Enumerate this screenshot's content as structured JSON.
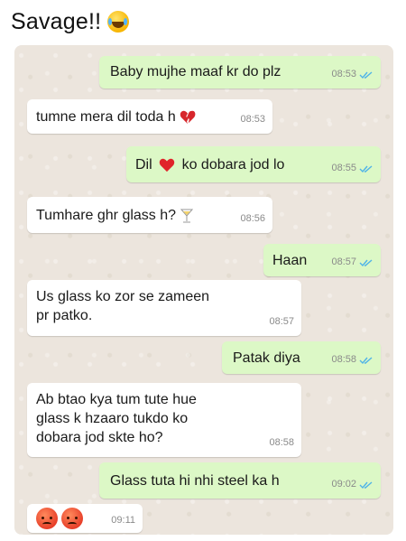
{
  "caption": {
    "text": "Savage!!",
    "emoji": "tears-of-joy-emoji"
  },
  "colors": {
    "chat_background": "#ece5dd",
    "outgoing_bubble": "#dcf8c6",
    "incoming_bubble": "#ffffff",
    "read_ticks": "#4fb3e8"
  },
  "messages": [
    {
      "direction": "out",
      "text": "Baby mujhe maaf kr do plz",
      "time": "08:53",
      "status": "read"
    },
    {
      "direction": "in",
      "text": "tumne mera dil toda h",
      "emoji": "broken-heart-emoji",
      "time": "08:53"
    },
    {
      "direction": "out",
      "text_before": "Dil",
      "emoji": "red-heart-emoji",
      "text_after": "ko dobara jod lo",
      "time": "08:55",
      "status": "read"
    },
    {
      "direction": "in",
      "text": "Tumhare ghr glass h?",
      "emoji": "cocktail-glass-emoji",
      "time": "08:56"
    },
    {
      "direction": "out",
      "text": "Haan",
      "time": "08:57",
      "status": "read"
    },
    {
      "direction": "in",
      "text_line1": "Us glass ko zor se zameen",
      "text_line2": "pr patko.",
      "time": "08:57"
    },
    {
      "direction": "out",
      "text": "Patak diya",
      "time": "08:58",
      "status": "read"
    },
    {
      "direction": "in",
      "text_line1": "Ab btao kya tum tute hue",
      "text_line2": "glass k hzaaro tukdo ko",
      "text_line3": "dobara jod skte ho?",
      "time": "08:58"
    },
    {
      "direction": "out",
      "text": "Glass tuta hi nhi steel ka h",
      "time": "09:02",
      "status": "read"
    },
    {
      "direction": "in",
      "emoji": "angry-face-emoji",
      "emoji_count": 2,
      "time": "09:11"
    }
  ]
}
